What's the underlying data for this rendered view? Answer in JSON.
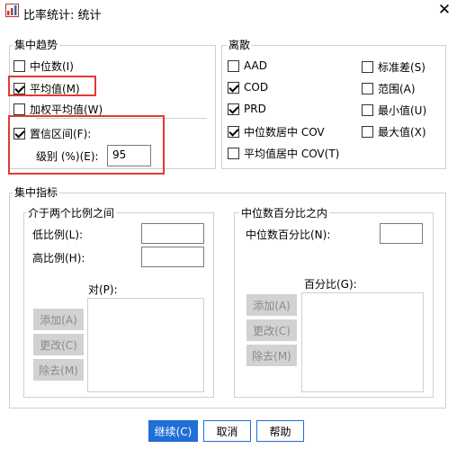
{
  "window": {
    "title": "比率统计: 统计",
    "close_glyph": "✕"
  },
  "central_tendency": {
    "legend": "集中趋势",
    "median": "中位数(I)",
    "mean": "平均值(M)",
    "weighted_mean": "加权平均值(W)",
    "confidence_interval": "置信区间(F):",
    "level_label": "级别 (%)(E):",
    "level_value": "95"
  },
  "dispersion": {
    "legend": "离散",
    "aad": "AAD",
    "cod": "COD",
    "prd": "PRD",
    "median_centered_cov": "中位数居中 COV",
    "mean_centered_cov": "平均值居中 COV(T)",
    "std_dev": "标准差(S)",
    "range": "范围(A)",
    "minimum": "最小值(U)",
    "maximum": "最大值(X)"
  },
  "concentration": {
    "legend": "集中指标",
    "between": {
      "legend": "介于两个比例之间",
      "low_label": "低比例(L):",
      "high_label": "高比例(H):",
      "pairs_label": "对(P):",
      "add": "添加(A)",
      "change": "更改(C)",
      "remove": "除去(M)"
    },
    "within_median": {
      "legend": "中位数百分比之内",
      "percent_of_median_label": "中位数百分比(N):",
      "percentages_label": "百分比(G):",
      "add": "添加(A)",
      "change": "更改(C)",
      "remove": "除去(M)"
    }
  },
  "buttons": {
    "continue": "继续(C)",
    "cancel": "取消",
    "help": "帮助"
  }
}
